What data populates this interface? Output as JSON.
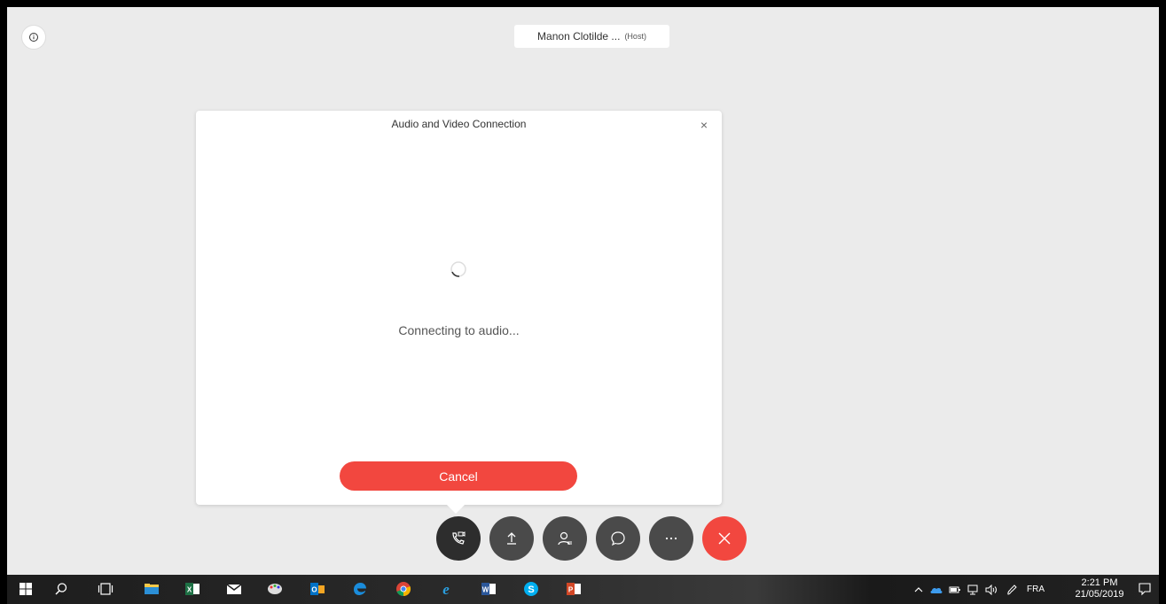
{
  "meeting": {
    "host_name": "Manon Clotilde ...",
    "host_tag": "(Host)"
  },
  "dialog": {
    "title": "Audio and Video Connection",
    "close_glyph": "×",
    "status": "Connecting to audio...",
    "cancel_label": "Cancel"
  },
  "controls": [
    {
      "name": "audio-connection",
      "icon": "phone-video-icon",
      "active": true
    },
    {
      "name": "share",
      "icon": "upload-arrow-icon"
    },
    {
      "name": "participants",
      "icon": "participants-icon"
    },
    {
      "name": "chat",
      "icon": "chat-bubble-icon"
    },
    {
      "name": "more",
      "icon": "more-dots-icon"
    },
    {
      "name": "leave",
      "icon": "close-x-icon",
      "color": "#f2473f"
    }
  ],
  "taskbar": {
    "apps": [
      "start-icon",
      "search-icon",
      "task-view-icon",
      "file-explorer-icon",
      "excel-icon",
      "mail-icon",
      "paint-icon",
      "outlook-icon",
      "edge-icon",
      "chrome-icon",
      "internet-explorer-icon",
      "word-icon",
      "skype-icon",
      "powerpoint-icon"
    ],
    "language": "FRA",
    "time": "2:21 PM",
    "date": "21/05/2019"
  },
  "colors": {
    "accent": "#f2473f",
    "background": "#ebebeb",
    "control": "#4a4a4a"
  }
}
